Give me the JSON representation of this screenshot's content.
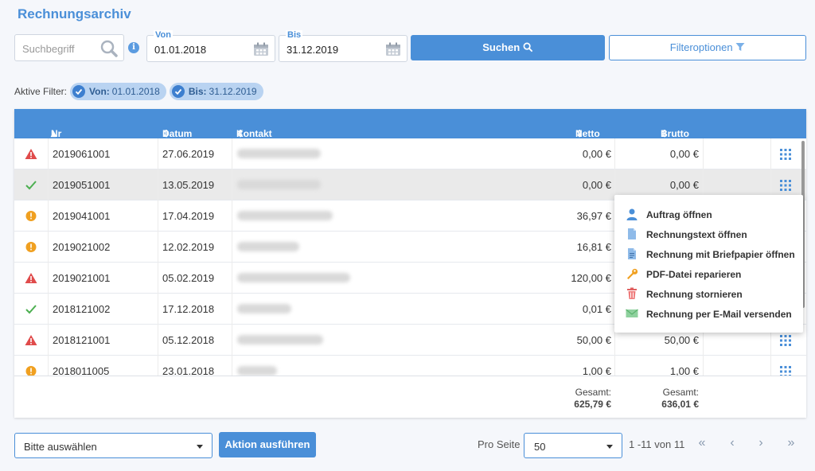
{
  "page": {
    "title": "Rechnungsarchiv"
  },
  "search": {
    "placeholder": "Suchbegriff",
    "von_label": "Von",
    "von_value": "01.01.2018",
    "bis_label": "Bis",
    "bis_value": "31.12.2019",
    "search_button": "Suchen",
    "filter_button": "Filteroptionen"
  },
  "active_filters": {
    "label": "Aktive Filter:",
    "chips": [
      {
        "key": "Von:",
        "value": "01.01.2018"
      },
      {
        "key": "Bis:",
        "value": "31.12.2019"
      }
    ]
  },
  "table": {
    "columns": {
      "nr": "Nr",
      "datum": "Datum",
      "kontakt": "Kontakt",
      "netto": "Netto",
      "brutto": "Brutto"
    },
    "rows": [
      {
        "status": "warning",
        "nr": "2019061001",
        "datum": "27.06.2019",
        "netto": "0,00 €",
        "brutto": "0,00 €"
      },
      {
        "status": "ok",
        "nr": "2019051001",
        "datum": "13.05.2019",
        "netto": "0,00 €",
        "brutto": "0,00 €"
      },
      {
        "status": "pending",
        "nr": "2019041001",
        "datum": "17.04.2019",
        "netto": "36,97 €",
        "brutto": ""
      },
      {
        "status": "pending",
        "nr": "2019021002",
        "datum": "12.02.2019",
        "netto": "16,81 €",
        "brutto": ""
      },
      {
        "status": "warning",
        "nr": "2019021001",
        "datum": "05.02.2019",
        "netto": "120,00 €",
        "brutto": ""
      },
      {
        "status": "ok",
        "nr": "2018121002",
        "datum": "17.12.2018",
        "netto": "0,01 €",
        "brutto": ""
      },
      {
        "status": "warning",
        "nr": "2018121001",
        "datum": "05.12.2018",
        "netto": "50,00 €",
        "brutto": "50,00 €"
      },
      {
        "status": "pending",
        "nr": "2018011005",
        "datum": "23.01.2018",
        "netto": "1,00 €",
        "brutto": "1,00 €"
      }
    ],
    "totals": {
      "netto_label": "Gesamt:",
      "netto": "625,79 €",
      "brutto_label": "Gesamt:",
      "brutto": "636,01 €"
    }
  },
  "context_menu": {
    "items": [
      {
        "icon": "user-icon",
        "label": "Auftrag öffnen"
      },
      {
        "icon": "document-icon",
        "label": "Rechnungstext öffnen"
      },
      {
        "icon": "letterhead-document-icon",
        "label": "Rechnung mit Briefpapier öffnen"
      },
      {
        "icon": "wrench-icon",
        "label": "PDF-Datei reparieren"
      },
      {
        "icon": "trash-icon",
        "label": "Rechnung stornieren"
      },
      {
        "icon": "envelope-icon",
        "label": "Rechnung per E-Mail versenden"
      }
    ]
  },
  "footer": {
    "action_select": "Bitte auswählen",
    "action_button": "Aktion ausführen",
    "per_page_label": "Pro Seite",
    "per_page_value": "50",
    "page_info": "1 -11 von 11"
  },
  "colors": {
    "accent": "#4a8fd8",
    "warning": "#e04b4b",
    "ok": "#4caf50",
    "pending": "#f0a020"
  }
}
